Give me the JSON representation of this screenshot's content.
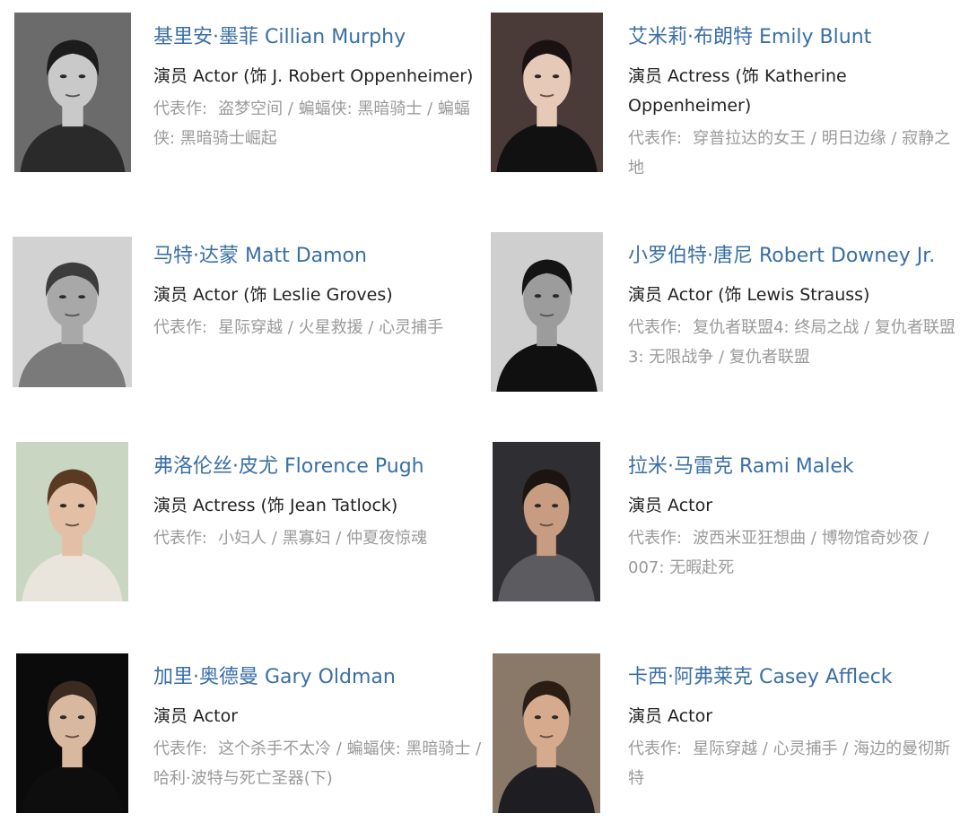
{
  "label_works": "代表作:",
  "cast": [
    {
      "name": "基里安·墨菲 Cillian Murphy",
      "role": "演员 Actor (饰 J. Robert Oppenheimer)",
      "works": "盗梦空间 / 蝙蝠侠: 黑暗骑士 / 蝙蝠侠: 黑暗骑士崛起",
      "photo": {
        "bg": "#6b6b6b",
        "skin": "#c9c9c9",
        "hair": "#1c1c1c",
        "cloth": "#2a2a2a",
        "gray": true
      }
    },
    {
      "name": "艾米莉·布朗特 Emily Blunt",
      "role": "演员 Actress (饰 Katherine Oppenheimer)",
      "works": "穿普拉达的女王 / 明日边缘 / 寂静之地",
      "photo": {
        "bg": "#4a3a38",
        "skin": "#e7c9b8",
        "hair": "#1a1212",
        "cloth": "#111111",
        "gray": false
      }
    },
    {
      "name": "马特·达蒙 Matt Damon",
      "role": "演员 Actor (饰 Leslie Groves)",
      "works": "星际穿越 / 火星救援 / 心灵捕手",
      "photo": {
        "bg": "#d2d2d2",
        "skin": "#a8a8a8",
        "hair": "#3c3c3c",
        "cloth": "#7a7a7a",
        "gray": true
      }
    },
    {
      "name": "小罗伯特·唐尼 Robert Downey Jr.",
      "role": "演员 Actor (饰 Lewis Strauss)",
      "works": "复仇者联盟4: 终局之战 / 复仇者联盟3: 无限战争 / 复仇者联盟",
      "photo": {
        "bg": "#cfcfcf",
        "skin": "#9c9c9c",
        "hair": "#141414",
        "cloth": "#101010",
        "gray": true
      }
    },
    {
      "name": "弗洛伦丝·皮尤 Florence Pugh",
      "role": "演员 Actress (饰 Jean Tatlock)",
      "works": "小妇人 / 黑寡妇 / 仲夏夜惊魂",
      "photo": {
        "bg": "#c9d6c2",
        "skin": "#e3bfa5",
        "hair": "#5a3a22",
        "cloth": "#e9e4dc",
        "gray": false
      }
    },
    {
      "name": "拉米·马雷克 Rami Malek",
      "role": "演员 Actor",
      "works": "波西米亚狂想曲 / 博物馆奇妙夜 / 007: 无暇赴死",
      "photo": {
        "bg": "#2f2f33",
        "skin": "#c79c80",
        "hair": "#1b1410",
        "cloth": "#5c5c60",
        "gray": false
      }
    },
    {
      "name": "加里·奥德曼 Gary Oldman",
      "role": "演员 Actor",
      "works": "这个杀手不太冷 / 蝙蝠侠: 黑暗骑士 / 哈利·波特与死亡圣器(下)",
      "photo": {
        "bg": "#0b0b0b",
        "skin": "#d9b8a0",
        "hair": "#3a2a20",
        "cloth": "#0e0e0e",
        "gray": false
      }
    },
    {
      "name": "卡西·阿弗莱克 Casey Affleck",
      "role": "演员 Actor",
      "works": "星际穿越 / 心灵捕手 / 海边的曼彻斯特",
      "photo": {
        "bg": "#8a7868",
        "skin": "#d6aa8c",
        "hair": "#2a1d14",
        "cloth": "#1e1e22",
        "gray": false
      }
    }
  ]
}
